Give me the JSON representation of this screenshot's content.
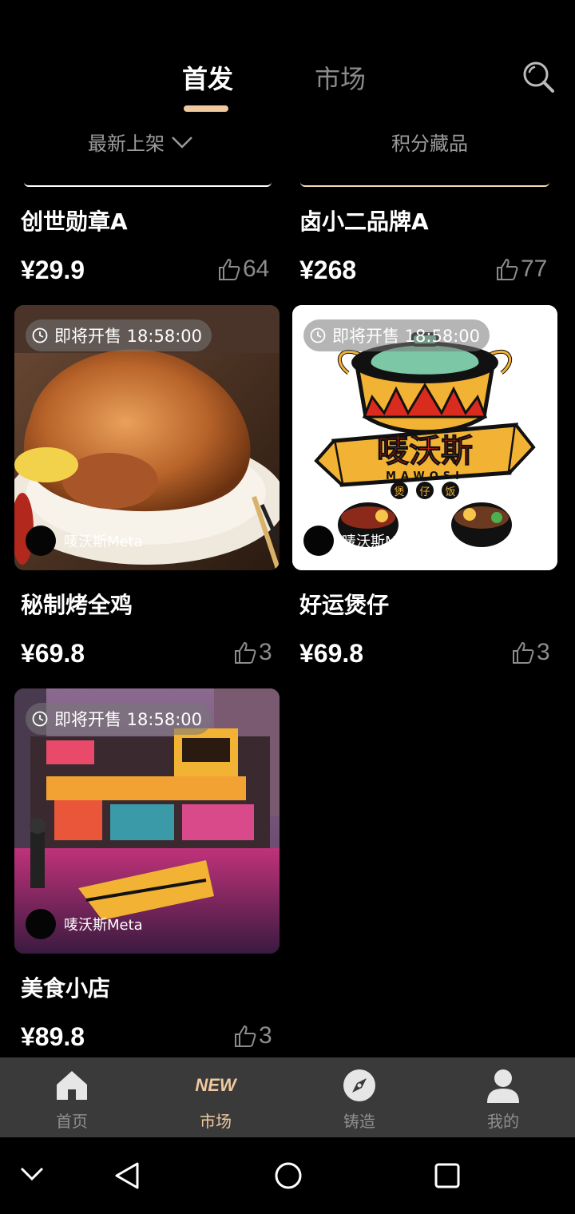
{
  "header": {
    "tabs": [
      {
        "label": "首发",
        "active": true
      },
      {
        "label": "市场",
        "active": false
      }
    ],
    "search_icon": "search-icon"
  },
  "filters": {
    "sort_label": "最新上架",
    "points_label": "积分藏品"
  },
  "colors": {
    "accent": "#f0c9a0",
    "background": "#000000",
    "nav_background": "#3a3a3a",
    "muted_text": "#8c8c8c"
  },
  "cards": [
    {
      "title": "创世勋章A",
      "price": "¥29.9",
      "likes": "64"
    },
    {
      "title": "卤小二品牌A",
      "price": "¥268",
      "likes": "77"
    },
    {
      "title": "秘制烤全鸡",
      "price": "¥69.8",
      "likes": "3",
      "badge": "即将开售 18:58:00",
      "creator": "唛沃斯Meta"
    },
    {
      "title": "好运煲仔",
      "price": "¥69.8",
      "likes": "3",
      "badge": "即将开售 18:58:00",
      "creator": "唛沃斯Meta",
      "logo_text": "唛沃斯",
      "logo_sub": "MAWOSI",
      "logo_chars": [
        "煲",
        "仔",
        "饭"
      ]
    },
    {
      "title": "美食小店",
      "price": "¥89.8",
      "likes": "3",
      "badge": "即将开售 18:58:00",
      "creator": "唛沃斯Meta"
    }
  ],
  "bottom_nav": [
    {
      "label": "首页",
      "icon": "home-icon",
      "active": false
    },
    {
      "label": "市场",
      "icon": "new-icon",
      "icon_text": "NEW",
      "active": true
    },
    {
      "label": "铸造",
      "icon": "compass-icon",
      "active": false
    },
    {
      "label": "我的",
      "icon": "user-icon",
      "active": false
    }
  ]
}
